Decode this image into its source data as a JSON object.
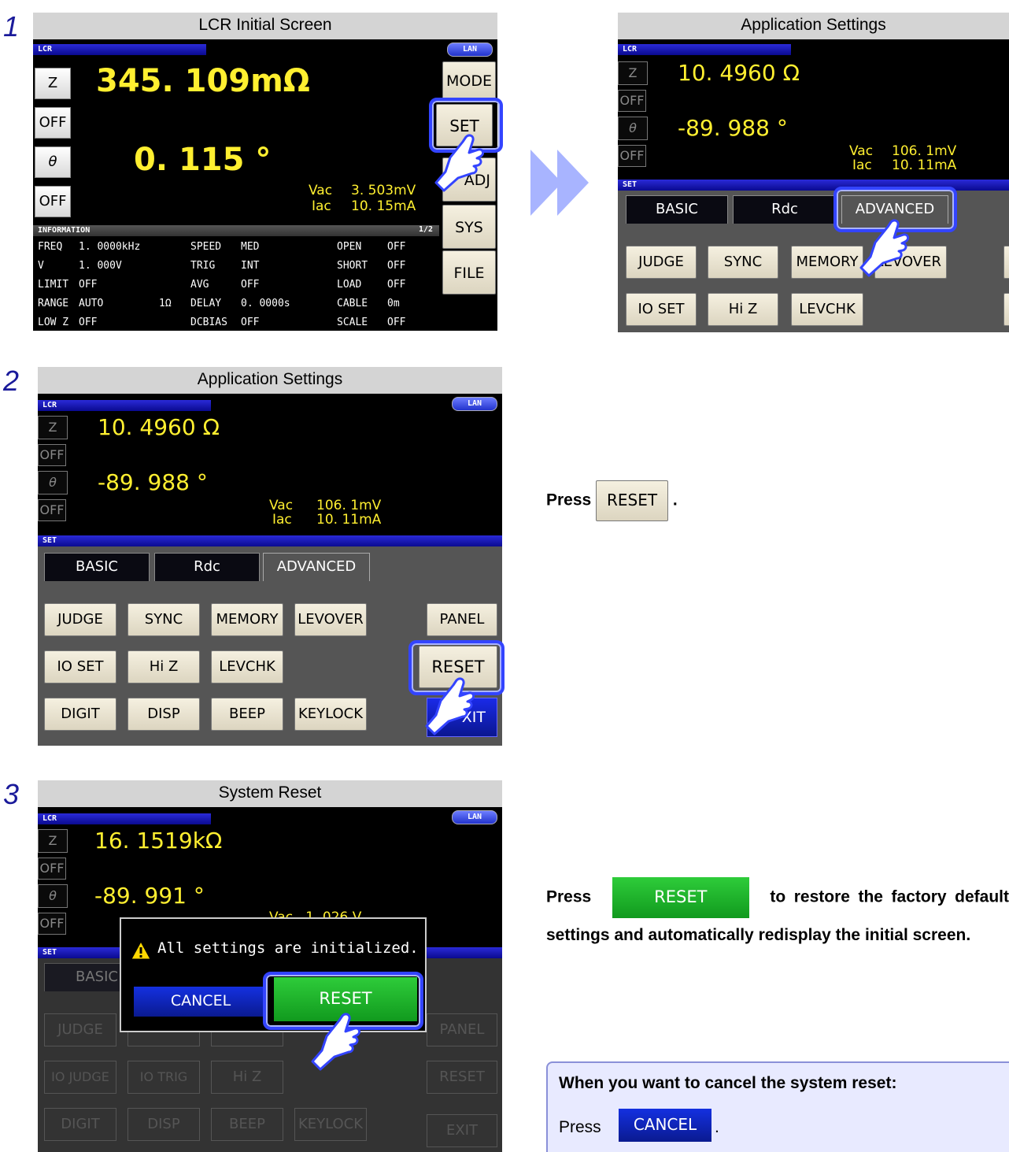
{
  "steps": [
    {
      "number": "1",
      "screens": [
        {
          "caption": "LCR Initial Screen",
          "mode_label": "LCR",
          "lan": "LAN",
          "params": [
            {
              "label": "Z",
              "value": "345. 109mΩ"
            },
            {
              "label": "OFF"
            },
            {
              "label": "θ",
              "value": "0. 115 °"
            },
            {
              "label": "OFF"
            }
          ],
          "vac_label": "Vac",
          "vac_value": "3. 503mV",
          "iac_label": "Iac",
          "iac_value": "10. 15mA",
          "side_buttons": [
            "MODE",
            "SET",
            "ADJ",
            "SYS",
            "FILE"
          ],
          "info_title": "INFORMATION",
          "info_page": "1/2",
          "info_rows": [
            [
              "FREQ",
              "1. 0000kHz",
              "",
              "SPEED",
              "MED",
              "OPEN",
              "OFF"
            ],
            [
              "V",
              "1. 000V",
              "",
              "TRIG",
              "INT",
              "SHORT",
              "OFF"
            ],
            [
              "LIMIT",
              "OFF",
              "",
              "AVG",
              "OFF",
              "LOAD",
              "OFF"
            ],
            [
              "RANGE",
              "AUTO",
              "1Ω",
              "DELAY",
              "0. 0000s",
              "CABLE",
              "0m"
            ],
            [
              "LOW Z",
              "OFF",
              "",
              "DCBIAS",
              "OFF",
              "SCALE",
              "OFF"
            ]
          ]
        },
        {
          "caption": "Application Settings",
          "mode_label": "LCR",
          "params": [
            {
              "label": "Z",
              "value": "10. 4960 Ω"
            },
            {
              "label": "OFF"
            },
            {
              "label": "θ",
              "value": "-89. 988 °"
            },
            {
              "label": "OFF"
            }
          ],
          "vac_label": "Vac",
          "vac_value": "106. 1mV",
          "iac_label": "Iac",
          "iac_value": "10. 11mA",
          "set_label": "SET",
          "tabs": [
            "BASIC",
            "Rdc",
            "ADVANCED"
          ],
          "buttons_row1": [
            "JUDGE",
            "SYNC",
            "MEMORY",
            "LEVOVER"
          ],
          "buttons_row2": [
            "IO SET",
            "Hi Z",
            "LEVCHK"
          ]
        }
      ]
    },
    {
      "number": "2",
      "caption": "Application Settings",
      "mode_label": "LCR",
      "lan": "LAN",
      "params": [
        {
          "label": "Z",
          "value": "10. 4960 Ω"
        },
        {
          "label": "OFF"
        },
        {
          "label": "θ",
          "value": "-89. 988 °"
        },
        {
          "label": "OFF"
        }
      ],
      "vac_label": "Vac",
      "vac_value": "106. 1mV",
      "iac_label": "Iac",
      "iac_value": "10. 11mA",
      "set_label": "SET",
      "tabs": [
        "BASIC",
        "Rdc",
        "ADVANCED"
      ],
      "buttons_row1": [
        "JUDGE",
        "SYNC",
        "MEMORY",
        "LEVOVER"
      ],
      "buttons_row2": [
        "IO SET",
        "Hi Z",
        "LEVCHK"
      ],
      "buttons_row3": [
        "DIGIT",
        "DISP",
        "BEEP",
        "KEYLOCK"
      ],
      "right_buttons": [
        "PANEL",
        "RESET",
        "EXIT"
      ],
      "instruction_prefix": "Press",
      "instruction_button": "RESET",
      "instruction_suffix": "."
    },
    {
      "number": "3",
      "caption": "System Reset",
      "mode_label": "LCR",
      "lan": "LAN",
      "params": [
        {
          "label": "Z",
          "value": "16. 1519kΩ"
        },
        {
          "label": "OFF"
        },
        {
          "label": "θ",
          "value": "-89. 991 °"
        },
        {
          "label": "OFF"
        }
      ],
      "vac_partial": "Vac   1. 026 V",
      "set_label": "SET",
      "tab_basic": "BASIC",
      "dialog_message": "All settings are initialized.",
      "dialog_cancel": "CANCEL",
      "dialog_reset": "RESET",
      "ghost_row1": [
        "JUDGE",
        "",
        "",
        "PANEL"
      ],
      "ghost_row2": [
        "IO JUDGE",
        "IO TRIG",
        "Hi Z",
        "RESET"
      ],
      "ghost_row3": [
        "DIGIT",
        "DISP",
        "BEEP",
        "KEYLOCK",
        "EXIT"
      ],
      "instruction_prefix": "Press",
      "instruction_button": "RESET",
      "instruction_text": "to restore the factory default settings and automatically redisplay the initial screen.",
      "note_title": "When you want to cancel the system reset:",
      "note_prefix": "Press",
      "note_button": "CANCEL",
      "note_suffix": "."
    }
  ],
  "colors": {
    "step_number": "#1a1a9a",
    "display_yellow": "#ffef30",
    "highlight_blue": "#3344ff",
    "reset_green": "#1dbb2a",
    "cancel_blue": "#0a28c8",
    "arrow": "#a8b4ff"
  }
}
